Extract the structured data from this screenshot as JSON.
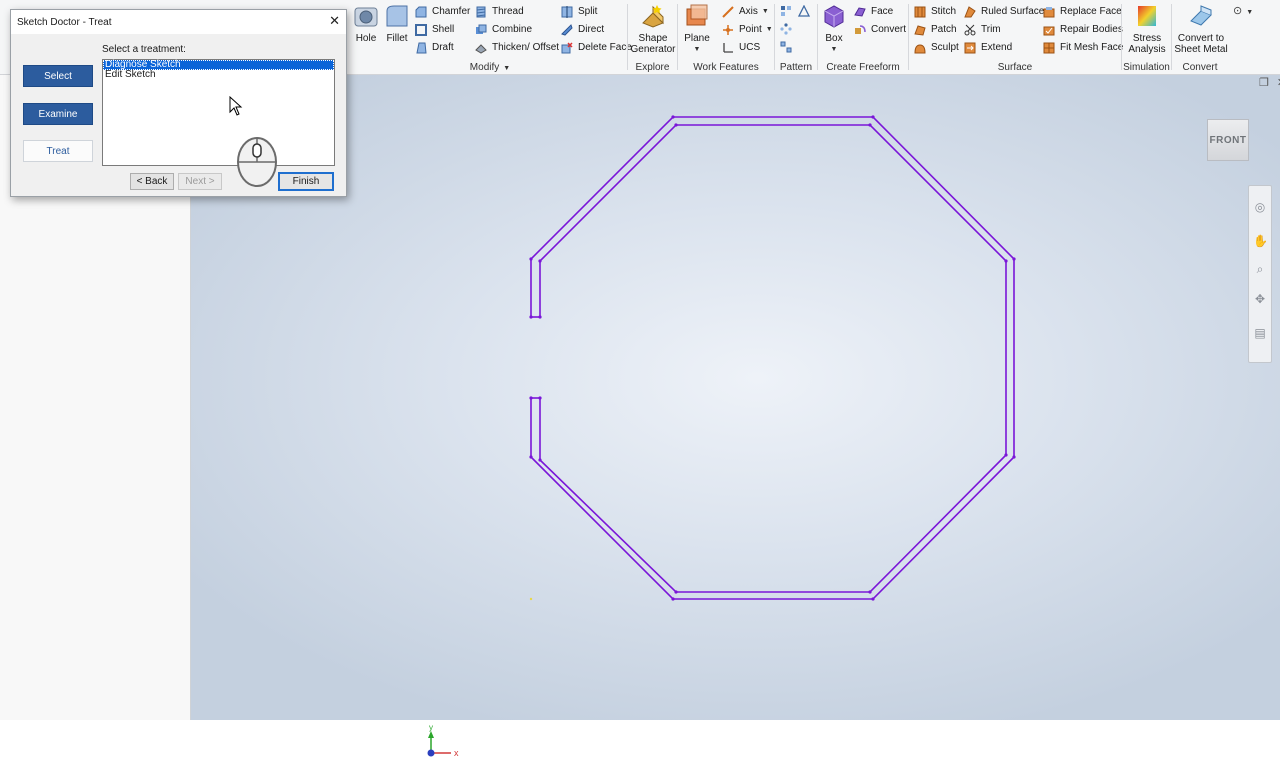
{
  "ribbon": {
    "modify": {
      "label": "Modify",
      "hole": "Hole",
      "fillet": "Fillet",
      "chamfer": "Chamfer",
      "shell": "Shell",
      "draft": "Draft",
      "thread": "Thread",
      "combine": "Combine",
      "thicken": "Thicken/ Offset",
      "split": "Split",
      "direct": "Direct",
      "delete_face": "Delete Face"
    },
    "explore": {
      "label": "Explore",
      "shape_generator_1": "Shape",
      "shape_generator_2": "Generator"
    },
    "work_features": {
      "label": "Work Features",
      "plane": "Plane",
      "axis": "Axis",
      "point": "Point",
      "ucs": "UCS"
    },
    "pattern": {
      "label": "Pattern"
    },
    "create_freeform": {
      "label": "Create Freeform",
      "box": "Box",
      "face": "Face",
      "convert": "Convert"
    },
    "surface": {
      "label": "Surface",
      "stitch": "Stitch",
      "patch": "Patch",
      "sculpt": "Sculpt",
      "ruled_surface": "Ruled Surface",
      "trim": "Trim",
      "extend": "Extend",
      "replace_face": "Replace Face",
      "repair_bodies": "Repair Bodies",
      "fit_mesh_face": "Fit Mesh Face"
    },
    "simulation": {
      "label": "Simulation",
      "stress_1": "Stress",
      "stress_2": "Analysis"
    },
    "convert": {
      "label": "Convert",
      "sheet_metal_1": "Convert to",
      "sheet_metal_2": "Sheet Metal"
    }
  },
  "dialog": {
    "title": "Sketch Doctor - Treat",
    "steps": [
      "Select",
      "Examine",
      "Treat"
    ],
    "prompt": "Select a treatment:",
    "treatments": [
      "Diagnose Sketch",
      "Edit Sketch"
    ],
    "selected_treatment": "Diagnose Sketch",
    "buttons": {
      "back": "< Back",
      "next": "Next >",
      "finish": "Finish"
    }
  },
  "viewport": {
    "viewcube_label": "FRONT",
    "axis_x": "x",
    "axis_y": "y",
    "sketch_color": "#7a16d8"
  },
  "colors": {
    "accent": "#2c5c9e",
    "selection": "#0a64d8"
  }
}
